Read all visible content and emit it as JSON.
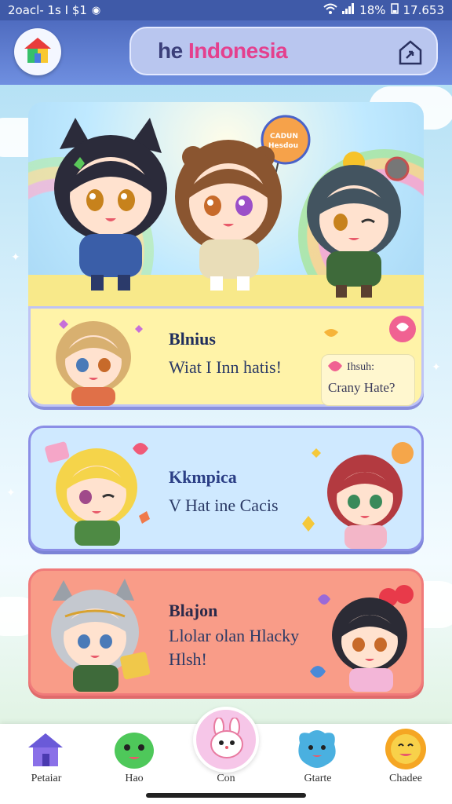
{
  "status_bar": {
    "left_text": "2oacl- 1s I $1",
    "battery": "18%",
    "time": "17.653",
    "icons": [
      "circle-icon",
      "wifi-icon",
      "signal-icon",
      "battery-icon"
    ]
  },
  "header": {
    "title_part1": "he ",
    "title_part2": "Indonesia",
    "home_icon": "house-icon",
    "share_icon": "share-icon"
  },
  "hero": {
    "balloon_text_1": "CADUN",
    "balloon_text_2": "Hesdou"
  },
  "cards": [
    {
      "title": "Blnius",
      "subtitle": "Wiat I Inn hatis!",
      "quote_line1": "Ihsuh:",
      "quote_line2": "Crany Hate?"
    },
    {
      "title": "Kkmpica",
      "subtitle": "V Hat ine Cacis"
    },
    {
      "title": "Blajon",
      "subtitle_line1": "Llolar olan Hlacky",
      "subtitle_line2": "Hlsh!"
    }
  ],
  "bottom_nav": {
    "items": [
      {
        "label": "Petaiar",
        "icon": "house-icon"
      },
      {
        "label": "Hao",
        "icon": "green-blob-icon"
      },
      {
        "label": "Con",
        "icon": "bunny-icon"
      },
      {
        "label": "Gtarte",
        "icon": "blue-blob-icon"
      },
      {
        "label": "Chadee",
        "icon": "sun-face-icon"
      }
    ]
  },
  "colors": {
    "status_bar": "#3f5aa8",
    "header": "#5a78cc",
    "title_accent": "#e4408e",
    "card1": "#fff3a8",
    "card2": "#cfe9ff",
    "card3": "#f99c88"
  }
}
